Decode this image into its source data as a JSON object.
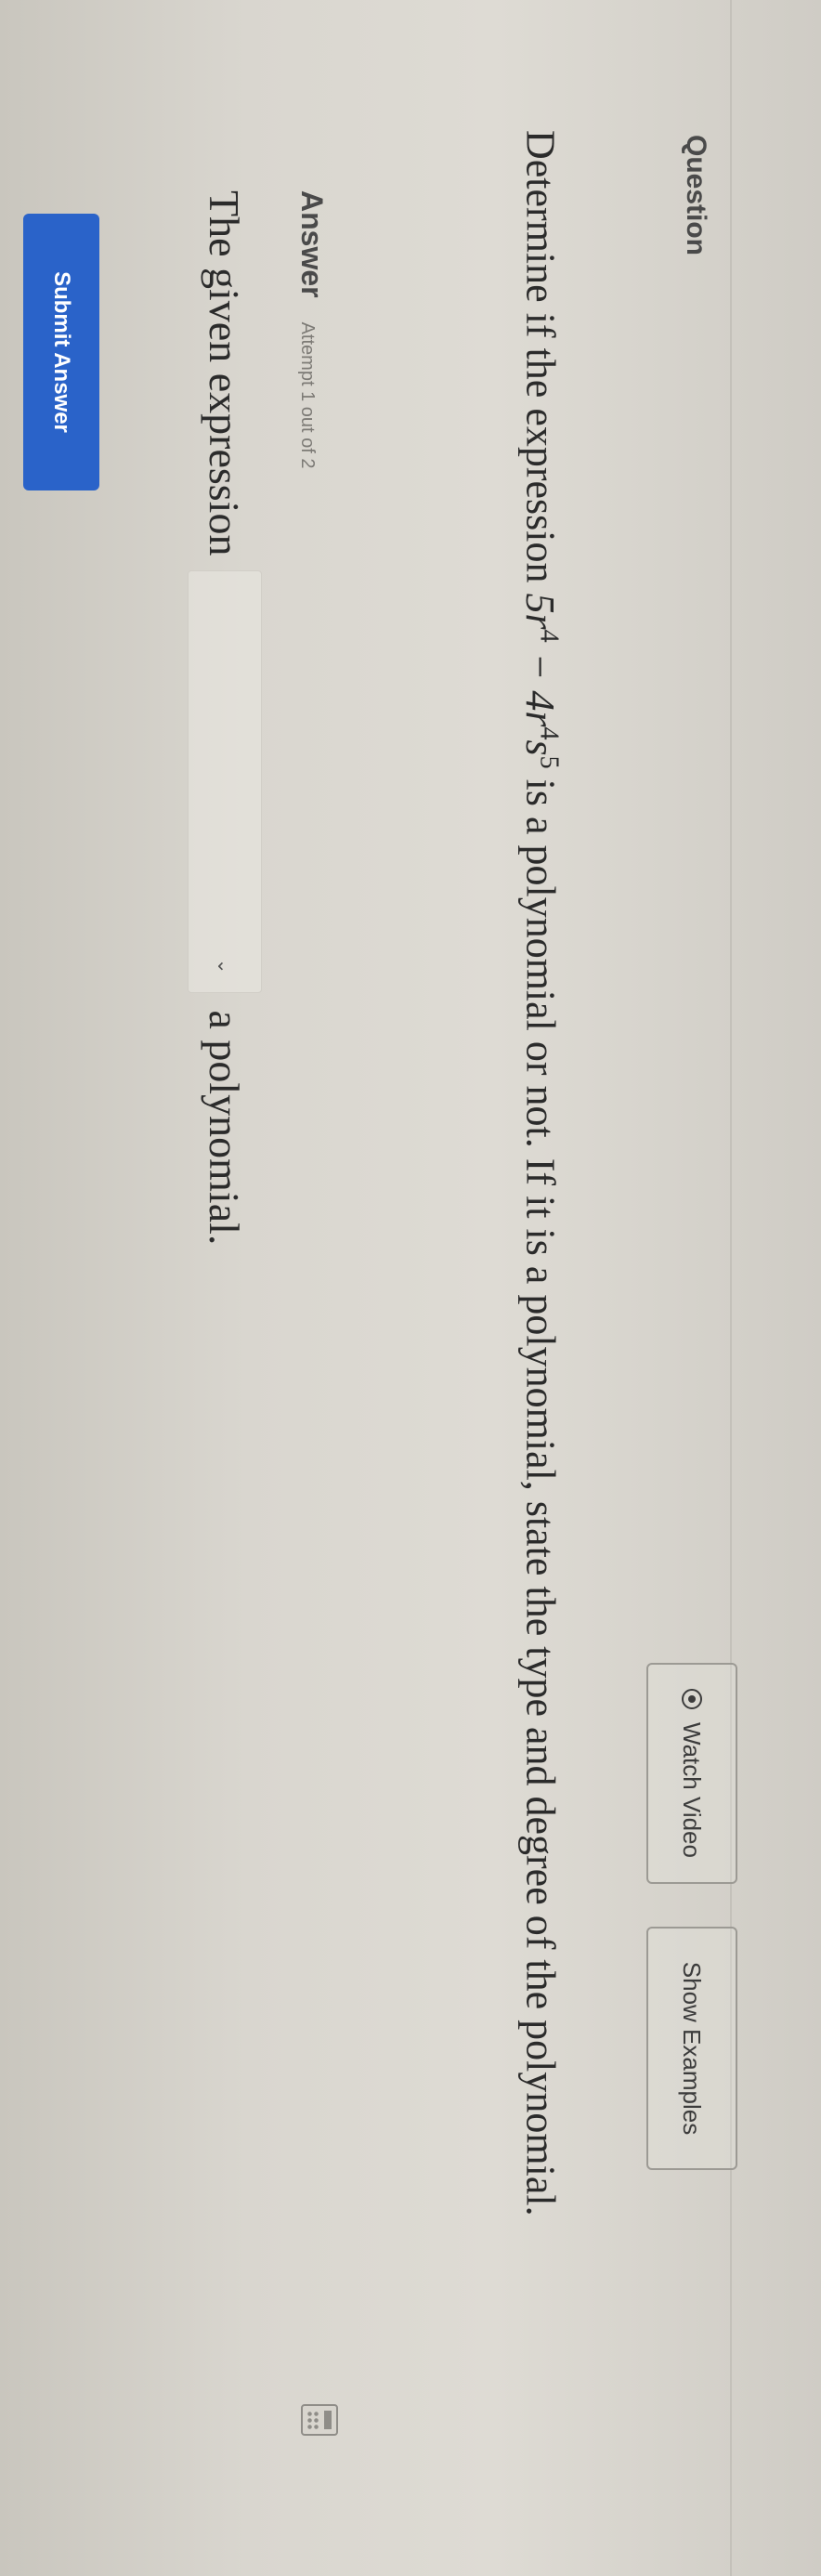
{
  "header": {
    "title": "Question",
    "watch_video_label": "Watch Video",
    "show_examples_label": "Show Examples"
  },
  "question": {
    "prefix": "Determine if the expression ",
    "expr_part1_coef": "5r",
    "expr_part1_exp": "4",
    "expr_minus": " − 4r",
    "expr_part2_exp1": "4",
    "expr_part2_var": "s",
    "expr_part2_exp2": "5",
    "suffix": " is a polynomial or not. If it is a polynomial, state the type and degree of the polynomial."
  },
  "answer": {
    "label": "Answer",
    "attempt_text": "Attempt 1 out of 2",
    "sentence_start": "The given expression",
    "sentence_end": "a polynomial.",
    "select_value": ""
  },
  "submit_label": "Submit Answer",
  "colors": {
    "submit_button": "#2a63c9",
    "background": "#dedbd4"
  },
  "icons": {
    "watch_video": "play-circle-icon",
    "dropdown": "chevron-down-icon",
    "calculator": "calculator-icon"
  }
}
